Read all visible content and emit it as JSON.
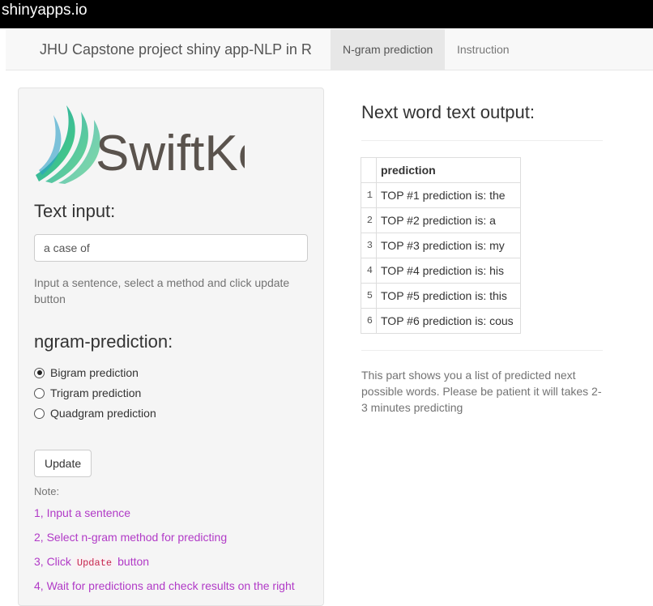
{
  "browser": {
    "title": "shinyapps.io"
  },
  "navbar": {
    "brand": "JHU Capstone project shiny app-NLP in R",
    "tabs": [
      {
        "label": "N-gram prediction",
        "active": true
      },
      {
        "label": "Instruction",
        "active": false
      }
    ]
  },
  "sidebar": {
    "logo_text": "SwiftKey",
    "text_input": {
      "title": "Text input:",
      "value": "a case of",
      "help": "Input a sentence, select a method and click update button"
    },
    "ngram": {
      "title": "ngram-prediction:",
      "options": [
        {
          "label": "Bigram prediction",
          "selected": true
        },
        {
          "label": "Trigram prediction",
          "selected": false
        },
        {
          "label": "Quadgram prediction",
          "selected": false
        }
      ]
    },
    "update_label": "Update",
    "note_label": "Note:",
    "steps": {
      "s1": "1, Input a sentence",
      "s2": "2, Select n-gram method for predicting",
      "s3_pre": "3, Click",
      "s3_code": "Update",
      "s3_post": "button",
      "s4": "4, Wait for predictions and check results on the right"
    }
  },
  "main": {
    "title": "Next word text output:",
    "table": {
      "header": "prediction",
      "rows": [
        {
          "idx": "1",
          "value": "TOP #1 prediction is: the"
        },
        {
          "idx": "2",
          "value": "TOP #2 prediction is: a"
        },
        {
          "idx": "3",
          "value": "TOP #3 prediction is: my"
        },
        {
          "idx": "4",
          "value": "TOP #4 prediction is: his"
        },
        {
          "idx": "5",
          "value": "TOP #5 prediction is: this"
        },
        {
          "idx": "6",
          "value": "TOP #6 prediction is: cous"
        }
      ]
    },
    "help": "This part shows you a list of predicted next possible words. Please be patient it will takes 2-3 minutes predicting"
  },
  "colors": {
    "accent": "#b13ac7",
    "logo_text": "#5a534d",
    "logo_teal": "#2aa8b4",
    "logo_green": "#4ad07a"
  }
}
